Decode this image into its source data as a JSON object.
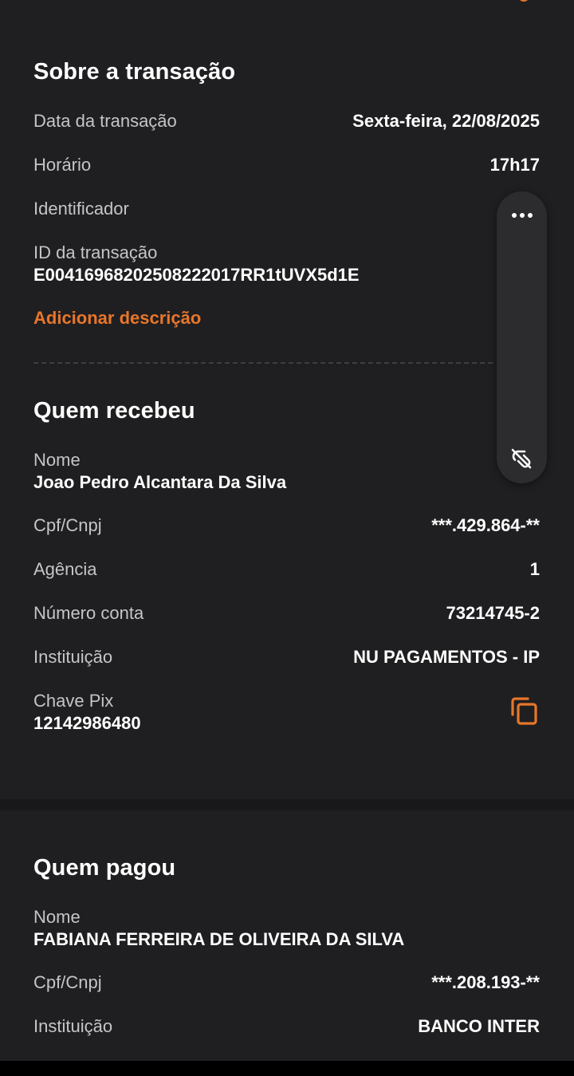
{
  "about": {
    "title": "Sobre a transação",
    "date_label": "Data da transação",
    "date_value": "Sexta-feira, 22/08/2025",
    "time_label": "Horário",
    "time_value": "17h17",
    "identifier_label": "Identificador",
    "txid_label": "ID da transação",
    "txid_value": "E00416968202508222017RR1tUVX5d1E",
    "add_description": "Adicionar descrição"
  },
  "receiver": {
    "title": "Quem recebeu",
    "name_label": "Nome",
    "name_value": "Joao Pedro Alcantara Da Silva",
    "doc_label": "Cpf/Cnpj",
    "doc_value": "***.429.864-**",
    "agency_label": "Agência",
    "agency_value": "1",
    "account_label": "Número conta",
    "account_value": "73214745-2",
    "institution_label": "Instituição",
    "institution_value": "NU PAGAMENTOS - IP",
    "pix_label": "Chave Pix",
    "pix_value": "12142986480"
  },
  "payer": {
    "title": "Quem pagou",
    "name_label": "Nome",
    "name_value": "FABIANA FERREIRA DE OLIVEIRA DA SILVA",
    "doc_label": "Cpf/Cnpj",
    "doc_value": "***.208.193-**",
    "institution_label": "Instituição",
    "institution_value": "BANCO INTER"
  },
  "icons": {
    "more": "more-horizontal-icon",
    "unlink": "unlink-icon",
    "copy": "copy-icon"
  },
  "colors": {
    "background": "#1f1f21",
    "accent": "#e8762a",
    "label": "#c5c5c7",
    "value": "#ffffff"
  }
}
